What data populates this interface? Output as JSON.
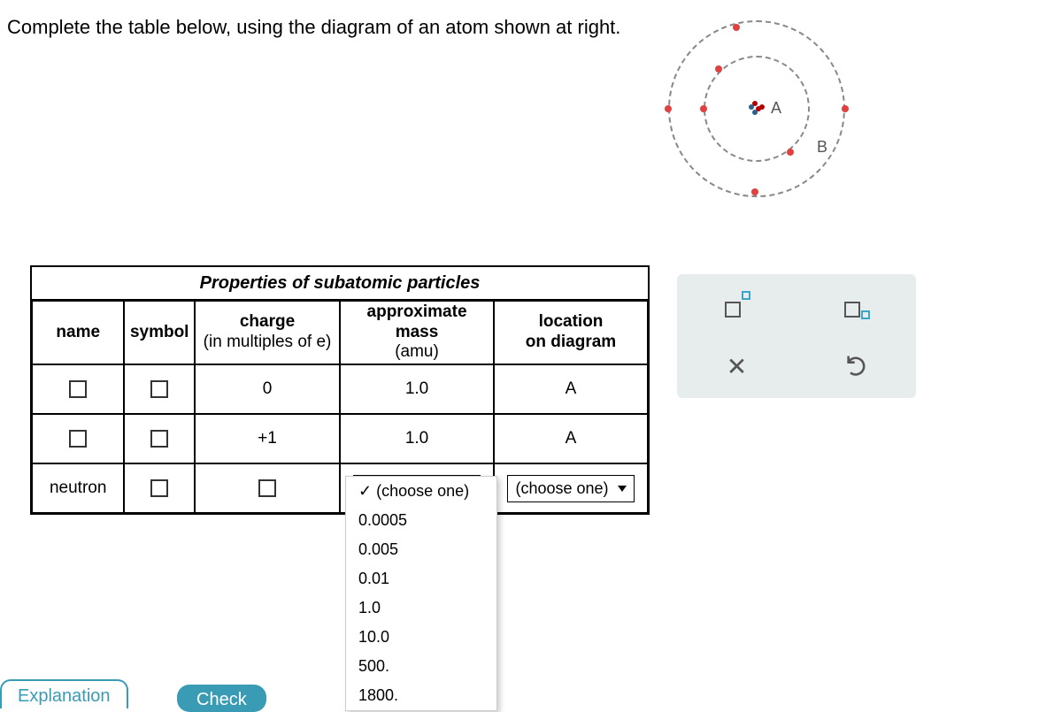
{
  "prompt": "Complete the table below, using the diagram of an atom shown at right.",
  "diagram": {
    "labelA": "A",
    "labelB": "B"
  },
  "table": {
    "title": "Properties of subatomic particles",
    "headers": {
      "name": "name",
      "symbol": "symbol",
      "charge_line1": "charge",
      "charge_line2": "(in multiples of e)",
      "mass_line1": "approximate",
      "mass_line2": "mass",
      "mass_line3": "(amu)",
      "location_line1": "location",
      "location_line2": "on diagram"
    },
    "rows": [
      {
        "name": "",
        "symbol": "",
        "charge": "0",
        "mass": "1.0",
        "location": "A"
      },
      {
        "name": "",
        "symbol": "",
        "charge": "+1",
        "mass": "1.0",
        "location": "A"
      },
      {
        "name": "neutron",
        "symbol": "",
        "charge": "",
        "mass_select": "(choose one)",
        "location_select": "(choose one)"
      }
    ]
  },
  "dropdown": {
    "selected": "(choose one)",
    "options": [
      "0.0005",
      "0.005",
      "0.01",
      "1.0",
      "10.0",
      "500.",
      "1800."
    ]
  },
  "buttons": {
    "explanation": "Explanation",
    "check": "Check"
  }
}
